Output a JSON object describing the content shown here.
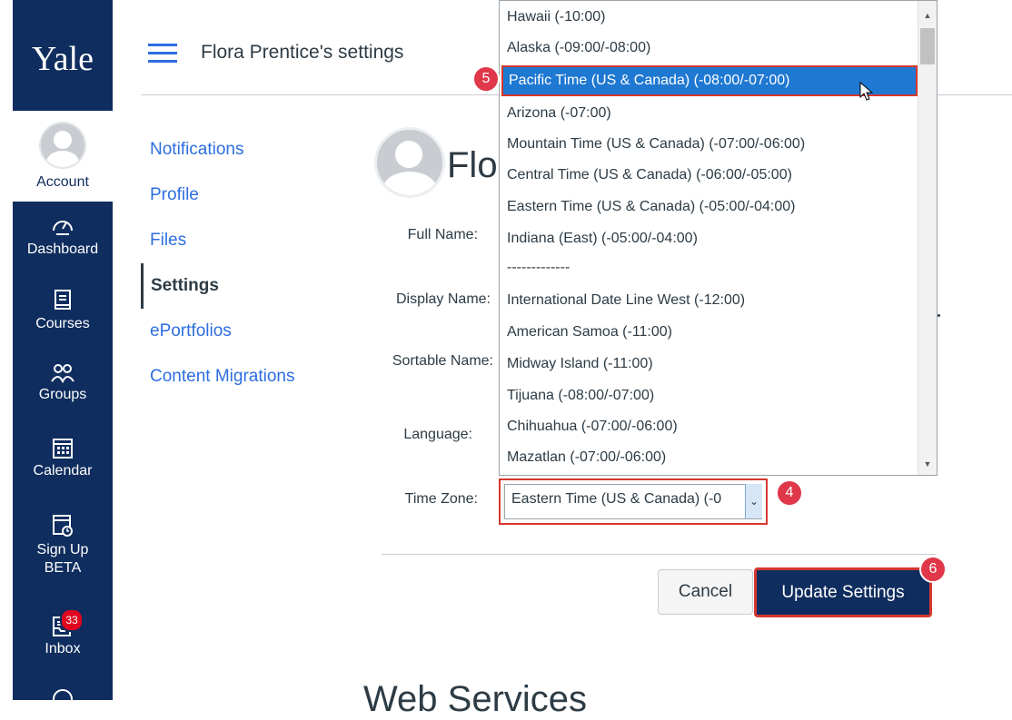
{
  "nav": {
    "logo": "Yale",
    "items": [
      {
        "label": "Account",
        "icon": "user-avatar-icon"
      },
      {
        "label": "Dashboard",
        "icon": "dashboard-icon"
      },
      {
        "label": "Courses",
        "icon": "courses-book-icon"
      },
      {
        "label": "Groups",
        "icon": "groups-icon"
      },
      {
        "label": "Calendar",
        "icon": "calendar-icon"
      },
      {
        "label": "Sign Up BETA",
        "line1": "Sign Up",
        "line2": "BETA",
        "icon": "signup-calendar-icon"
      },
      {
        "label": "Inbox",
        "icon": "inbox-icon",
        "badge": "33"
      }
    ]
  },
  "header": {
    "title": "Flora Prentice's settings"
  },
  "subnav": [
    "Notifications",
    "Profile",
    "Files",
    "Settings",
    "ePortfolios",
    "Content Migrations"
  ],
  "profile": {
    "name_partial": "Flo"
  },
  "form": {
    "labels": {
      "full_name": "Full Name:",
      "display_name": "Display Name:",
      "sortable_name": "Sortable Name:",
      "language": "Language:",
      "time_zone": "Time Zone:"
    },
    "time_zone_value": "Eastern Time (US & Canada) (-0"
  },
  "dropdown": {
    "options": [
      "Hawaii (-10:00)",
      "Alaska (-09:00/-08:00)",
      "Pacific Time (US & Canada) (-08:00/-07:00)",
      "Arizona (-07:00)",
      "Mountain Time (US & Canada) (-07:00/-06:00)",
      "Central Time (US & Canada) (-06:00/-05:00)",
      "Eastern Time (US & Canada) (-05:00/-04:00)",
      "Indiana (East) (-05:00/-04:00)",
      "-------------",
      "International Date Line West (-12:00)",
      "American Samoa (-11:00)",
      "Midway Island (-11:00)",
      "Tijuana (-08:00/-07:00)",
      "Chihuahua (-07:00/-06:00)",
      "Mazatlan (-07:00/-06:00)"
    ],
    "selected": "Pacific Time (US & Canada) (-08:00/-07:00)"
  },
  "markers": {
    "dropdown_step": "5",
    "select_step": "4",
    "update_step": "6"
  },
  "buttons": {
    "cancel": "Cancel",
    "update": "Update Settings"
  },
  "section_heading_partial": "Web Services",
  "colors": {
    "nav_bg": "#0f2d5e",
    "link": "#2d6ee0",
    "highlight": "#1f78d1",
    "annotation": "#d6372e"
  }
}
